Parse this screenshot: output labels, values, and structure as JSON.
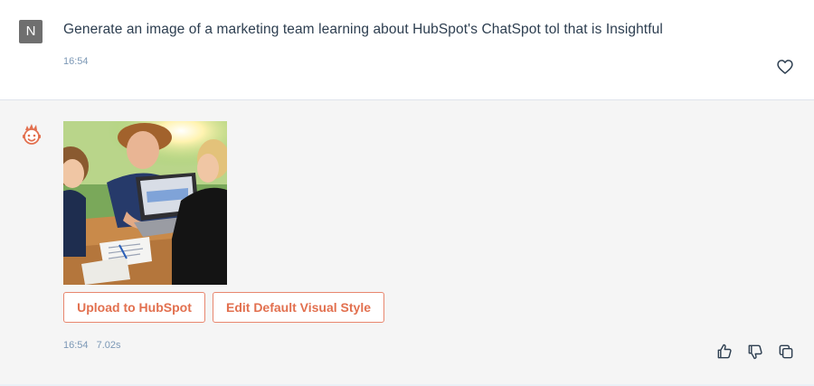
{
  "user_message": {
    "avatar_initial": "N",
    "text": "Generate an image of a marketing team learning about HubSpot's ChatSpot tol that is Insightful",
    "time": "16:54",
    "like_icon": "heart-icon"
  },
  "bot_message": {
    "avatar_icon": "chatspot-bot-icon",
    "image_icon": "generated-image",
    "buttons": {
      "upload": "Upload to HubSpot",
      "edit_style": "Edit Default Visual Style"
    },
    "time": "16:54",
    "duration": "7.02s",
    "actions": [
      "thumbs-up-icon",
      "thumbs-down-icon",
      "copy-icon"
    ]
  },
  "colors": {
    "accent": "#e2704f",
    "bot_bg": "#f5f5f5",
    "text": "#2d3e50",
    "meta": "#7c98b6"
  }
}
